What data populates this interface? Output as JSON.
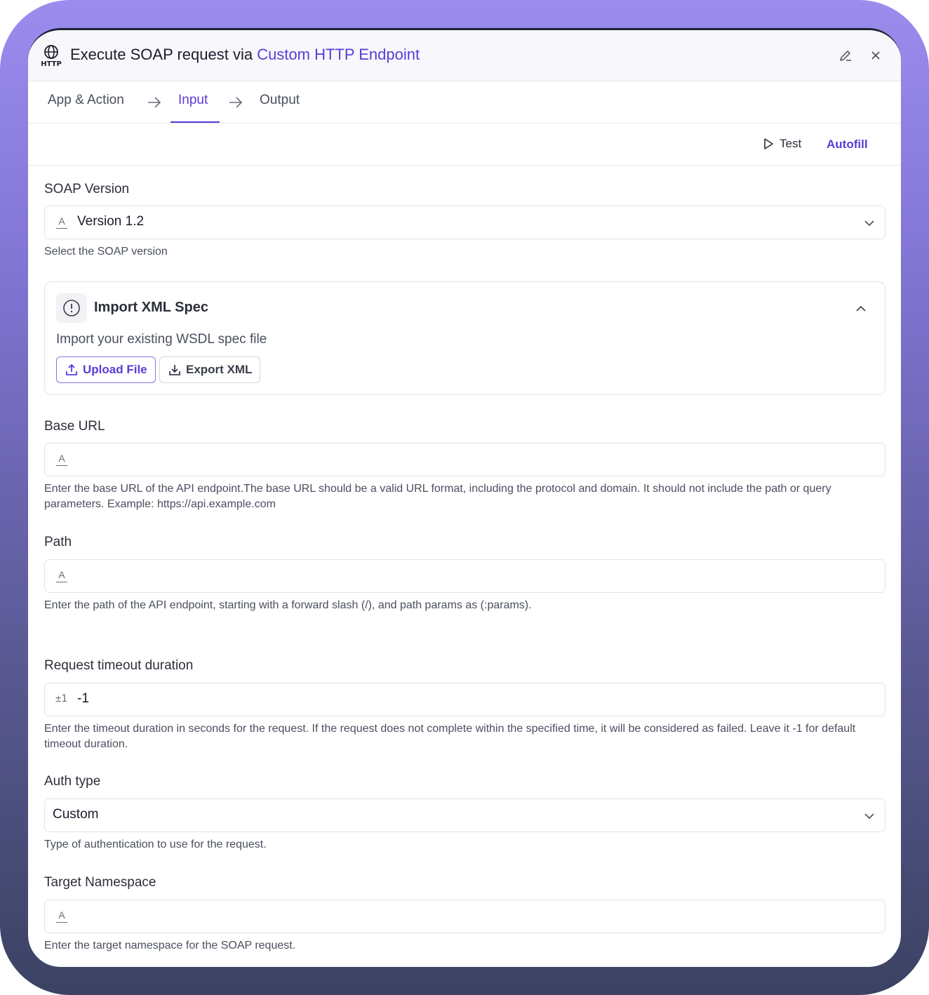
{
  "header": {
    "app_icon": "http-globe-icon",
    "title_prefix": "Execute SOAP request via ",
    "title_accent": "Custom HTTP Endpoint",
    "edit_icon": "pencil-icon",
    "close_icon": "close-icon"
  },
  "tabs": [
    {
      "label": "App & Action",
      "active": false
    },
    {
      "label": "Input",
      "active": true
    },
    {
      "label": "Output",
      "active": false
    }
  ],
  "toolbar": {
    "test_label": "Test",
    "autofill_label": "Autofill"
  },
  "fields": {
    "soap_version": {
      "label": "SOAP Version",
      "value": "Version 1.2",
      "help": "Select the SOAP version"
    },
    "import_card": {
      "title": "Import XML Spec",
      "description": "Import your existing WSDL spec file",
      "upload_label": "Upload File",
      "export_label": "Export XML"
    },
    "base_url": {
      "label": "Base URL",
      "value": "",
      "help": "Enter the base URL of the API endpoint.The base URL should be a valid URL format, including the protocol and domain. It should not include the path or query parameters. Example: https://api.example.com"
    },
    "path": {
      "label": "Path",
      "value": "",
      "help": "Enter the path of the API endpoint, starting with a forward slash (/), and path params as (:params)."
    },
    "timeout": {
      "label": "Request timeout duration",
      "type_icon": "±1",
      "value": "-1",
      "help": "Enter the timeout duration in seconds for the request. If the request does not complete within the specified time, it will be considered as failed. Leave it -1 for default timeout duration."
    },
    "auth_type": {
      "label": "Auth type",
      "value": "Custom",
      "help": "Type of authentication to use for the request."
    },
    "target_namespace": {
      "label": "Target Namespace",
      "value": "",
      "help": "Enter the target namespace for the SOAP request."
    }
  },
  "colors": {
    "accent": "#5b3bd6",
    "frame_top": "#9b8cee",
    "frame_bottom": "#3b4262"
  }
}
